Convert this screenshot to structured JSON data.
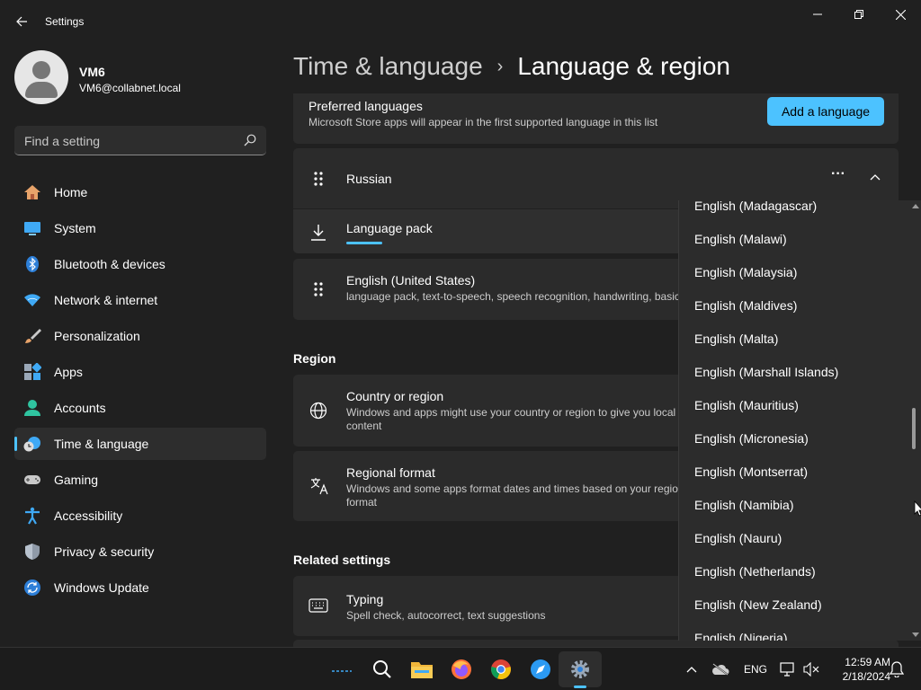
{
  "window": {
    "title": "Settings"
  },
  "profile": {
    "name": "VM6",
    "email": "VM6@collabnet.local"
  },
  "search": {
    "placeholder": "Find a setting"
  },
  "sidebar": {
    "items": [
      {
        "label": "Home",
        "icon": "home-icon"
      },
      {
        "label": "System",
        "icon": "system-icon"
      },
      {
        "label": "Bluetooth & devices",
        "icon": "bluetooth-icon"
      },
      {
        "label": "Network & internet",
        "icon": "network-icon"
      },
      {
        "label": "Personalization",
        "icon": "brush-icon"
      },
      {
        "label": "Apps",
        "icon": "apps-icon"
      },
      {
        "label": "Accounts",
        "icon": "accounts-icon"
      },
      {
        "label": "Time & language",
        "icon": "time-language-icon",
        "active": true
      },
      {
        "label": "Gaming",
        "icon": "gamepad-icon"
      },
      {
        "label": "Accessibility",
        "icon": "accessibility-icon"
      },
      {
        "label": "Privacy & security",
        "icon": "shield-icon"
      },
      {
        "label": "Windows Update",
        "icon": "update-icon"
      }
    ]
  },
  "header": {
    "parent": "Time & language",
    "separator": "›",
    "current": "Language & region"
  },
  "preferred": {
    "title": "Preferred languages",
    "subtitle": "Microsoft Store apps will appear in the first supported language in this list",
    "add_button": "Add a language"
  },
  "languages": {
    "russian": {
      "label": "Russian",
      "more": "···",
      "pack_label": "Language pack"
    },
    "english_us": {
      "label": "English (United States)",
      "subtitle": "language pack, text-to-speech, speech recognition, handwriting, basic typing"
    }
  },
  "region": {
    "heading": "Region",
    "country_title": "Country or region",
    "country_sub_1": "Windows and apps might use your country or region to give you local",
    "country_sub_2": "content",
    "format_title": "Regional format",
    "format_sub_1": "Windows and some apps format dates and times based on your regional",
    "format_sub_2": "format"
  },
  "related": {
    "heading": "Related settings",
    "typing_title": "Typing",
    "typing_sub": "Spell check, autocorrect, text suggestions"
  },
  "dropdown": {
    "options": [
      "English (Madagascar)",
      "English (Malawi)",
      "English (Malaysia)",
      "English (Maldives)",
      "English (Malta)",
      "English (Marshall Islands)",
      "English (Mauritius)",
      "English (Micronesia)",
      "English (Montserrat)",
      "English (Namibia)",
      "English (Nauru)",
      "English (Netherlands)",
      "English (New Zealand)",
      "English (Nigeria)"
    ],
    "scroll_position": 0.5
  },
  "taskbar": {
    "language": "ENG",
    "time": "12:59 AM",
    "date": "2/18/2024"
  },
  "colors": {
    "accent": "#4cc2ff",
    "background": "#202020",
    "card": "#2b2b2b"
  }
}
